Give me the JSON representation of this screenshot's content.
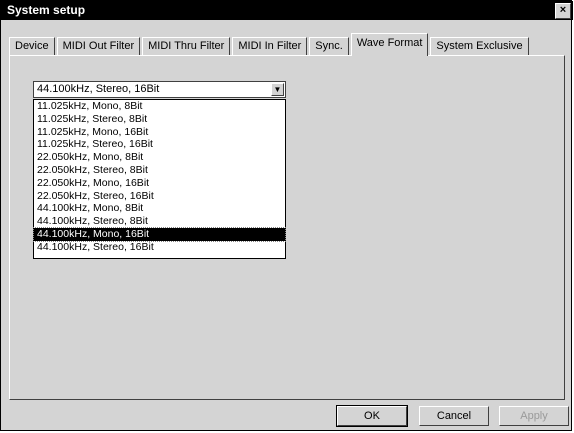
{
  "window": {
    "title": "System setup",
    "close_label": "×"
  },
  "tabs": [
    {
      "label": "Device"
    },
    {
      "label": "MIDI Out Filter"
    },
    {
      "label": "MIDI Thru Filter"
    },
    {
      "label": "MIDI In Filter"
    },
    {
      "label": "Sync."
    },
    {
      "label": "Wave Format",
      "active": true
    },
    {
      "label": "System Exclusive"
    }
  ],
  "wave_format": {
    "selected_value": "44.100kHz, Stereo, 16Bit",
    "options": [
      "11.025kHz, Mono, 8Bit",
      "11.025kHz, Stereo, 8Bit",
      "11.025kHz, Mono, 16Bit",
      "11.025kHz, Stereo, 16Bit",
      "22.050kHz, Mono, 8Bit",
      "22.050kHz, Stereo, 8Bit",
      "22.050kHz, Mono, 16Bit",
      "22.050kHz, Stereo, 16Bit",
      "44.100kHz, Mono, 8Bit",
      "44.100kHz, Stereo, 8Bit",
      "44.100kHz, Mono, 16Bit",
      "44.100kHz, Stereo, 16Bit"
    ],
    "highlighted_option": "44.100kHz, Mono, 16Bit"
  },
  "buttons": {
    "ok": "OK",
    "cancel": "Cancel",
    "apply": "Apply"
  }
}
